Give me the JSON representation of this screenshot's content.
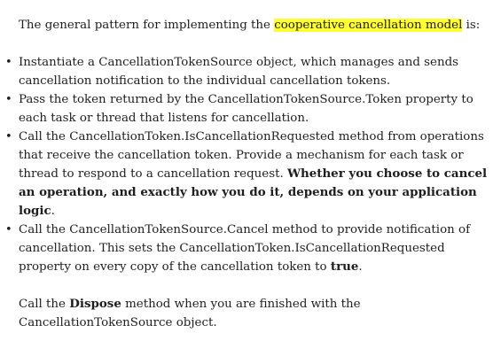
{
  "intro": {
    "text_before": "The general pattern for implementing the ",
    "highlight": "cooperative cancellation model",
    "text_after": " is:"
  },
  "steps": [
    {
      "text1": "Instantiate a CancellationTokenSource object, which manages and sends cancellation notification to the individual cancellation tokens."
    },
    {
      "text1": "Pass the token returned by the CancellationTokenSource.Token property to each task or thread that listens for cancellation."
    },
    {
      "text1": "Call the CancellationToken.IsCancellationRequested method from operations that receive the cancellation token. Provide a mechanism for each task or thread to respond to a cancellation request. ",
      "bold": "Whether you choose to cancel an operation, and exactly how you do it, depends on your application logic",
      "text2": "."
    },
    {
      "text1": "Call the CancellationTokenSource.Cancel method to provide notification of cancellation. This sets the CancellationToken.IsCancellationRequested property on every copy of the cancellation token to ",
      "bold": "true",
      "text2": "."
    }
  ],
  "outro": {
    "text_before": "Call the ",
    "bold": "Dispose",
    "text_after": " method when you are finished with the CancellationTokenSource object."
  },
  "bullet_glyph": "•"
}
